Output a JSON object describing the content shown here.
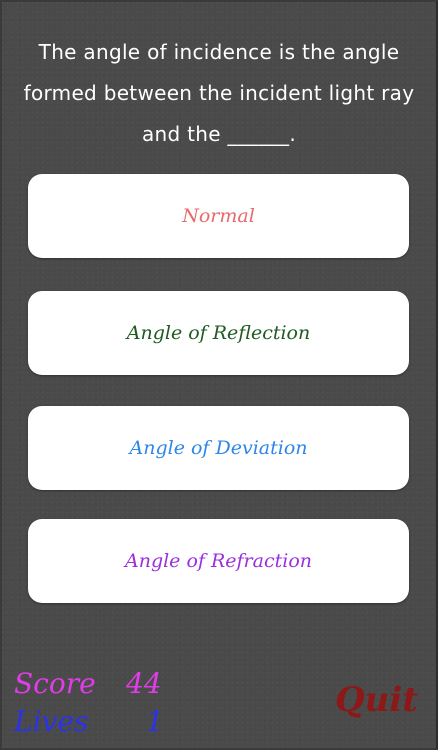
{
  "question": {
    "text": "The angle of incidence is the angle formed between the incident light ray and the ______."
  },
  "answers": [
    {
      "label": "Normal",
      "color": "#e86a6a"
    },
    {
      "label": "Angle of Reflection",
      "color": "#1f5a22"
    },
    {
      "label": "Angle of Deviation",
      "color": "#2f86e8"
    },
    {
      "label": "Angle of Refraction",
      "color": "#9a2fe0"
    }
  ],
  "hud": {
    "score_label": "Score",
    "score_value": "44",
    "score_color": "#e03ce8",
    "lives_label": "Lives",
    "lives_value": "1",
    "lives_color": "#2a32f0",
    "quit_label": "Quit",
    "quit_color": "#8c1818"
  }
}
